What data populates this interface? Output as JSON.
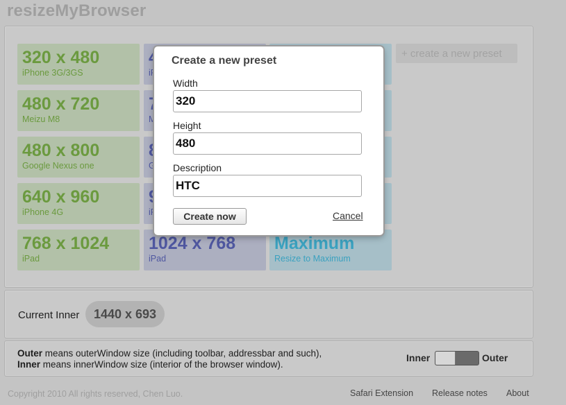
{
  "app": {
    "title": "resizeMyBrowser"
  },
  "presets": [
    {
      "size": "320 x 480",
      "desc": "iPhone 3G/3GS",
      "color": "green"
    },
    {
      "size": "480 x 720",
      "desc": "Meizu M8",
      "color": "green"
    },
    {
      "size": "480 x 800",
      "desc": "Google Nexus one",
      "color": "green"
    },
    {
      "size": "640 x 960",
      "desc": "iPhone 4G",
      "color": "green"
    },
    {
      "size": "768 x 1024",
      "desc": "iPad",
      "color": "green"
    },
    {
      "size": "4",
      "desc": "iP",
      "color": "blue"
    },
    {
      "size": "7",
      "desc": "M",
      "color": "blue"
    },
    {
      "size": "8",
      "desc": "G",
      "color": "blue"
    },
    {
      "size": "9",
      "desc": "iP",
      "color": "blue"
    },
    {
      "size": "1024 x 768",
      "desc": "iPad",
      "color": "blue"
    },
    {
      "size": "Maximum",
      "desc": "Resize to Maximum",
      "color": "cyan"
    }
  ],
  "create_preset_link": "+ create a new preset",
  "current": {
    "label": "Current Inner",
    "value": "1440 x 693"
  },
  "info": {
    "outer_term": "Outer",
    "outer_text": " means outerWindow size (including toolbar, addressbar and such),",
    "inner_term": "Inner",
    "inner_text": " means innerWindow size (interior of the browser window)."
  },
  "toggle": {
    "left_label": "Inner",
    "right_label": "Outer",
    "state": "Inner"
  },
  "footer": {
    "copyright": "Copyright 2010 All rights reserved, Chen Luo.",
    "links": [
      "Safari Extension",
      "Release notes",
      "About"
    ]
  },
  "modal": {
    "title": "Create a new preset",
    "width_label": "Width",
    "width_value": "320",
    "height_label": "Height",
    "height_value": "480",
    "description_label": "Description",
    "description_value": "HTC",
    "create_button": "Create now",
    "cancel_link": "Cancel"
  },
  "colors": {
    "green_text": "#6b9a3f",
    "blue_text": "#4f57a0",
    "cyan_text": "#3aa1bf",
    "backdrop": "#c4c4c4"
  }
}
